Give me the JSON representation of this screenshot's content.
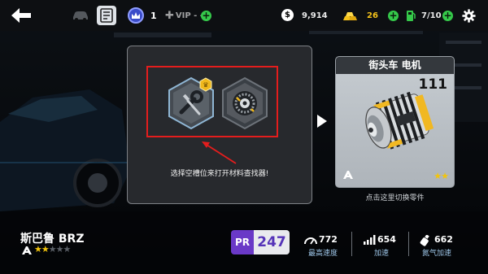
{
  "topbar": {
    "crown_count": "1",
    "vip_label": "VIP - -",
    "cash": "9,914",
    "gold": "26",
    "fuel": "7/10",
    "cash_symbol": "$"
  },
  "panel": {
    "hint_text": "选择空槽位来打开材料查找器!",
    "highlight_color": "#e41d1d"
  },
  "part_card": {
    "title": "街头车 电机",
    "rating": "111",
    "stars": "★★",
    "footer": "点击这里切换零件"
  },
  "car": {
    "name": "斯巴鲁 BRZ",
    "class_icon": "class-a-icon",
    "stars_filled": "★★",
    "stars_empty": "★★★"
  },
  "pr": {
    "label": "PR",
    "value": "247"
  },
  "stats": [
    {
      "value": "772",
      "label": "最高速度",
      "icon": "speedometer-icon"
    },
    {
      "value": "654",
      "label": "加速",
      "icon": "acceleration-icon"
    },
    {
      "value": "662",
      "label": "氮气加速",
      "icon": "nitro-icon"
    }
  ],
  "colors": {
    "accent_purple": "#6a39c7",
    "gold": "#f4c21a",
    "plus_green": "#35c94a",
    "star_yellow": "#f2c40c"
  }
}
